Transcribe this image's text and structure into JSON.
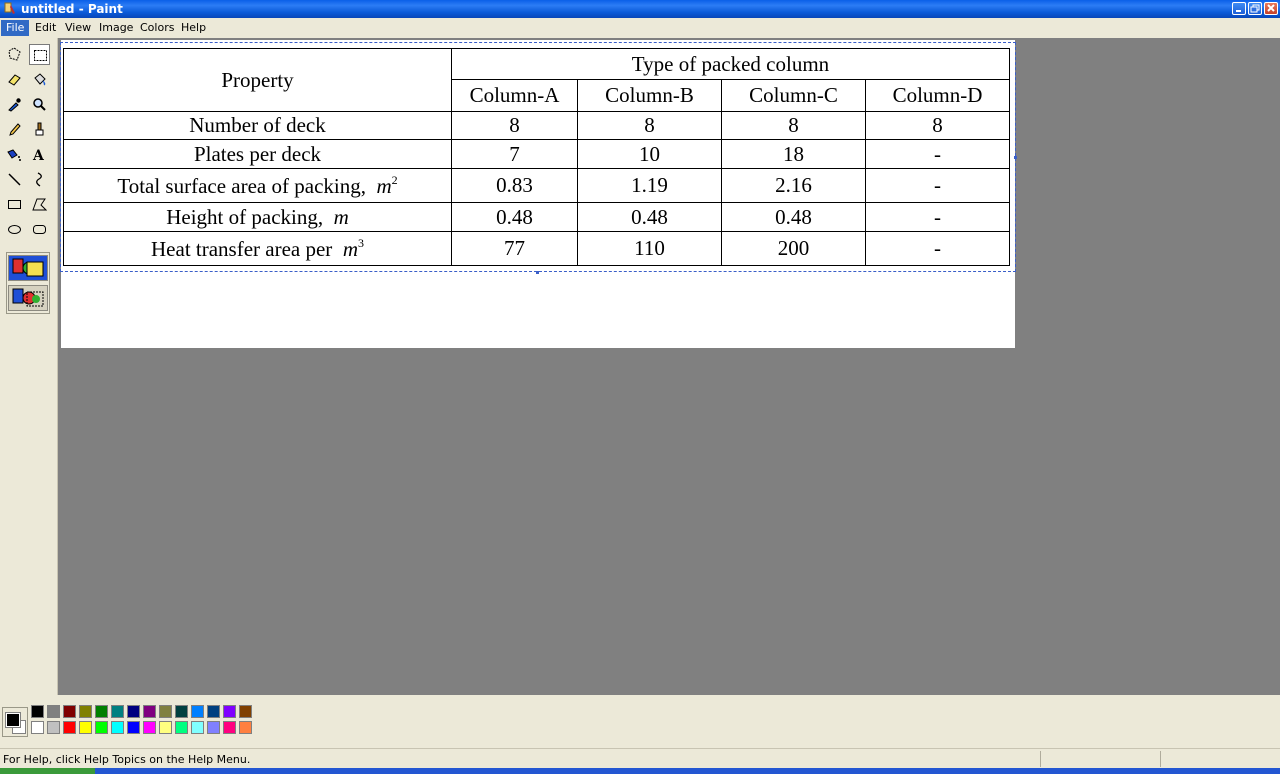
{
  "window": {
    "title": "untitled - Paint",
    "icons": {
      "app": "paint-app-icon",
      "minimize": "minimize-icon",
      "maximize": "maximize-icon",
      "close": "close-icon"
    }
  },
  "menu": {
    "file": "File",
    "edit": "Edit",
    "view": "View",
    "image": "Image",
    "colors": "Colors",
    "help": "Help",
    "active": "File"
  },
  "tools": [
    {
      "name": "free-form-select-icon"
    },
    {
      "name": "select-icon",
      "pressed": true
    },
    {
      "name": "eraser-icon"
    },
    {
      "name": "fill-with-color-icon"
    },
    {
      "name": "pick-color-icon"
    },
    {
      "name": "magnifier-icon"
    },
    {
      "name": "pencil-icon"
    },
    {
      "name": "brush-icon"
    },
    {
      "name": "airbrush-icon"
    },
    {
      "name": "text-icon",
      "glyph": "A"
    },
    {
      "name": "line-icon"
    },
    {
      "name": "curve-icon"
    },
    {
      "name": "rectangle-icon"
    },
    {
      "name": "polygon-icon"
    },
    {
      "name": "ellipse-icon"
    },
    {
      "name": "rounded-rectangle-icon"
    }
  ],
  "table": {
    "property_header": "Property",
    "group_header": "Type of packed column",
    "columns": [
      "Column-A",
      "Column-B",
      "Column-C",
      "Column-D"
    ],
    "rows": [
      {
        "label": "Number of deck",
        "unit": "",
        "power": "",
        "values": [
          "8",
          "8",
          "8",
          "8"
        ]
      },
      {
        "label": "Plates per deck",
        "unit": "",
        "power": "",
        "values": [
          "7",
          "10",
          "18",
          "-"
        ]
      },
      {
        "label": "Total surface area of packing,",
        "unit": "m",
        "power": "2",
        "values": [
          "0.83",
          "1.19",
          "2.16",
          "-"
        ]
      },
      {
        "label": "Height of packing,",
        "unit": "m",
        "power": "",
        "values": [
          "0.48",
          "0.48",
          "0.48",
          "-"
        ]
      },
      {
        "label": "Heat transfer area per",
        "unit": "m",
        "power": "3",
        "values": [
          "77",
          "110",
          "200",
          "-"
        ]
      }
    ]
  },
  "palette": {
    "foreground": "#000000",
    "background": "#ffffff",
    "top": [
      "#000000",
      "#808080",
      "#800000",
      "#808000",
      "#008000",
      "#008080",
      "#000080",
      "#800080",
      "#808040",
      "#004040",
      "#0080ff",
      "#004080",
      "#8000ff",
      "#804000"
    ],
    "bottom": [
      "#ffffff",
      "#c0c0c0",
      "#ff0000",
      "#ffff00",
      "#00ff00",
      "#00ffff",
      "#0000ff",
      "#ff00ff",
      "#ffff80",
      "#00ff80",
      "#80ffff",
      "#8080ff",
      "#ff0080",
      "#ff8040"
    ]
  },
  "status": {
    "help_text": "For Help, click Help Topics on the Help Menu."
  }
}
